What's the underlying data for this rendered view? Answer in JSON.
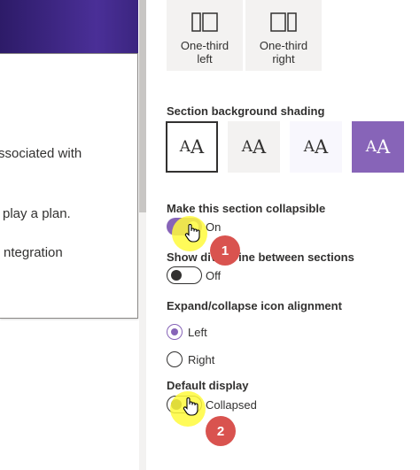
{
  "canvas": {
    "lines": [
      "ssociated with",
      "play a plan.",
      "ntegration"
    ]
  },
  "layouts": [
    {
      "label_line1": "One-third",
      "label_line2": "left",
      "icon": "one-third-left-layout-icon"
    },
    {
      "label_line1": "One-third",
      "label_line2": "right",
      "icon": "one-third-right-layout-icon"
    }
  ],
  "shading": {
    "label": "Section background shading",
    "swatch_text": "A",
    "swatches": [
      {
        "name": "none",
        "bg": "#ffffff",
        "fg": "#323130"
      },
      {
        "name": "neutral",
        "bg": "#f3f2f1",
        "fg": "#323130"
      },
      {
        "name": "soft",
        "bg": "#f8f7fd",
        "fg": "#323130"
      },
      {
        "name": "strong",
        "bg": "#8764b8",
        "fg": "#ffffff"
      }
    ]
  },
  "collapsible": {
    "label": "Make this section collapsible",
    "state": "On"
  },
  "divider": {
    "label_start": "Show div",
    "label_end": "ine between sections",
    "state": "Off"
  },
  "alignment": {
    "label": "Expand/collapse icon alignment",
    "options": [
      "Left",
      "Right"
    ],
    "selected": "Left"
  },
  "default_display": {
    "label": "Default display",
    "state": "Collapsed"
  },
  "callouts": [
    "1",
    "2"
  ],
  "colors": {
    "accent": "#8764b8",
    "badge": "#d9534f",
    "highlight": "#fffa3c"
  }
}
